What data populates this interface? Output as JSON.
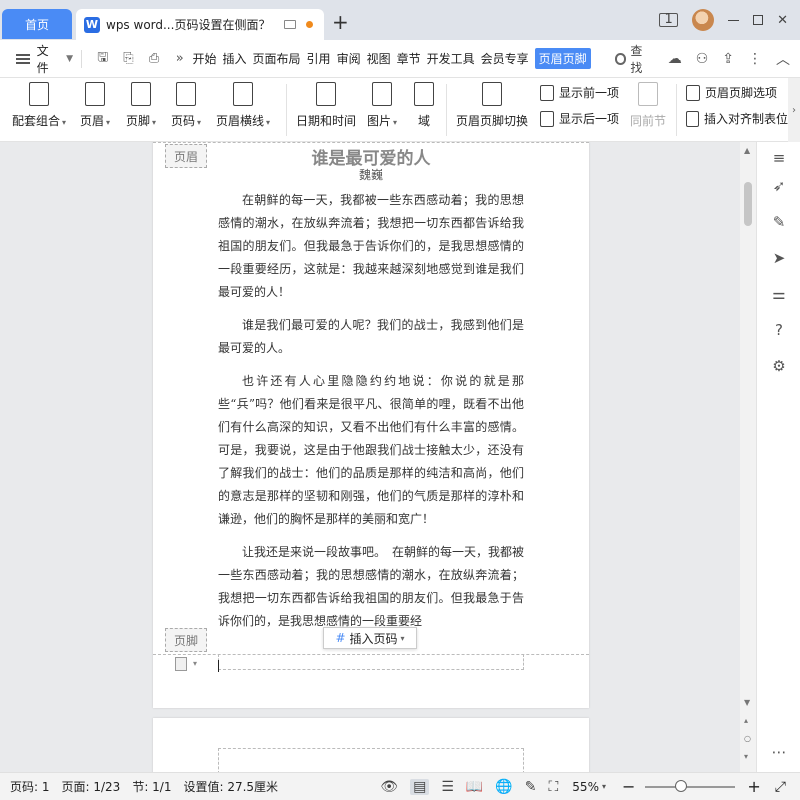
{
  "titlebar": {
    "home_tab": "首页",
    "doc_tab_title": "wps word...页码设置在侧面？",
    "window_number_badge": "1"
  },
  "menubar": {
    "file_label": "文件",
    "items": [
      "开始",
      "插入",
      "页面布局",
      "引用",
      "审阅",
      "视图",
      "章节",
      "开发工具",
      "会员专享"
    ],
    "active_item": "页眉页脚",
    "search_label": "查找"
  },
  "ribbon": {
    "match_combo": "配套组合",
    "header": "页眉",
    "footer": "页脚",
    "page_number": "页码",
    "header_line": "页眉横线",
    "date_time": "日期和时间",
    "picture": "图片",
    "field": "域",
    "switch_header_footer": "页眉页脚切换",
    "show_prev": "显示前一项",
    "show_next": "显示后一项",
    "same_as_prev": "同前节",
    "header_footer_options": "页眉页脚选项",
    "insert_align_tab": "插入对齐制表位"
  },
  "document": {
    "header_tag": "页眉",
    "footer_tag": "页脚",
    "title": "谁是最可爱的人",
    "author": "魏巍",
    "paragraphs": [
      "在朝鲜的每一天，我都被一些东西感动着；我的思想感情的潮水，在放纵奔流着；我想把一切东西都告诉给我祖国的朋友们。但我最急于告诉你们的，是我思想感情的一段重要经历，这就是：我越来越深刻地感觉到谁是我们最可爱的人！",
      "谁是我们最可爱的人呢？我们的战士，我感到他们是最可爱的人。",
      "也许还有人心里隐隐约约地说：你说的就是那些“兵”吗？他们看来是很平凡、很简单的哩，既看不出他们有什么高深的知识，又看不出他们有什么丰富的感情。可是，我要说，这是由于他跟我们战士接触太少，还没有了解我们的战士：他们的品质是那样的纯洁和高尚，他们的意志是那样的坚韧和刚强，他们的气质是那样的淳朴和谦逊，他们的胸怀是那样的美丽和宽广！",
      "让我还是来说一段故事吧。　在朝鲜的每一天，我都被一些东西感动着；我的思想感情的潮水，在放纵奔流着；我想把一切东西都告诉给我祖国的朋友们。但我最急于告诉你们的，是我思想感情的一段重要经"
    ],
    "insert_page_number": "插入页码"
  },
  "statusbar": {
    "page_num": "页码: 1",
    "page": "页面: 1/23",
    "section": "节: 1/1",
    "setting": "设置值: 27.5厘米",
    "zoom": "55%"
  },
  "colors": {
    "accent": "#4a8bf5",
    "titlebar_bg": "#dfe3ea",
    "doc_bg": "#e9eaec"
  }
}
